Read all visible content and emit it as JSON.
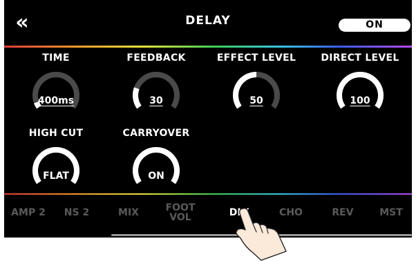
{
  "header": {
    "back_icon": "double-chevron-left-icon",
    "back_glyph": "«",
    "title": "DELAY",
    "on_label": "ON"
  },
  "params": [
    {
      "label": "TIME",
      "value": "400ms",
      "level": 0.06,
      "underline": true
    },
    {
      "label": "FEEDBACK",
      "value": "30",
      "level": 0.22,
      "underline": true
    },
    {
      "label": "EFFECT LEVEL",
      "value": "50",
      "level": 0.5,
      "underline": true
    },
    {
      "label": "DIRECT LEVEL",
      "value": "100",
      "level": 1.0,
      "underline": true
    },
    {
      "label": "HIGH CUT",
      "value": "FLAT",
      "level": 1.0,
      "underline": false
    },
    {
      "label": "CARRYOVER",
      "value": "ON",
      "level": 1.0,
      "underline": false
    }
  ],
  "tabs": [
    {
      "label": "AMP 2",
      "active": false
    },
    {
      "label": "NS 2",
      "active": false
    },
    {
      "label": "MIX",
      "active": false
    },
    {
      "label": "FOOT VOL",
      "active": false
    },
    {
      "label": "DLY",
      "active": true
    },
    {
      "label": "CHO",
      "active": false
    },
    {
      "label": "REV",
      "active": false
    },
    {
      "label": "MST",
      "active": false
    }
  ],
  "colors": {
    "background": "#000000",
    "arc_active": "#ffffff",
    "arc_inactive": "#4a4a4a",
    "tab_inactive": "#5a5a5a"
  },
  "overlay": {
    "icon": "tapping-hand-icon"
  }
}
